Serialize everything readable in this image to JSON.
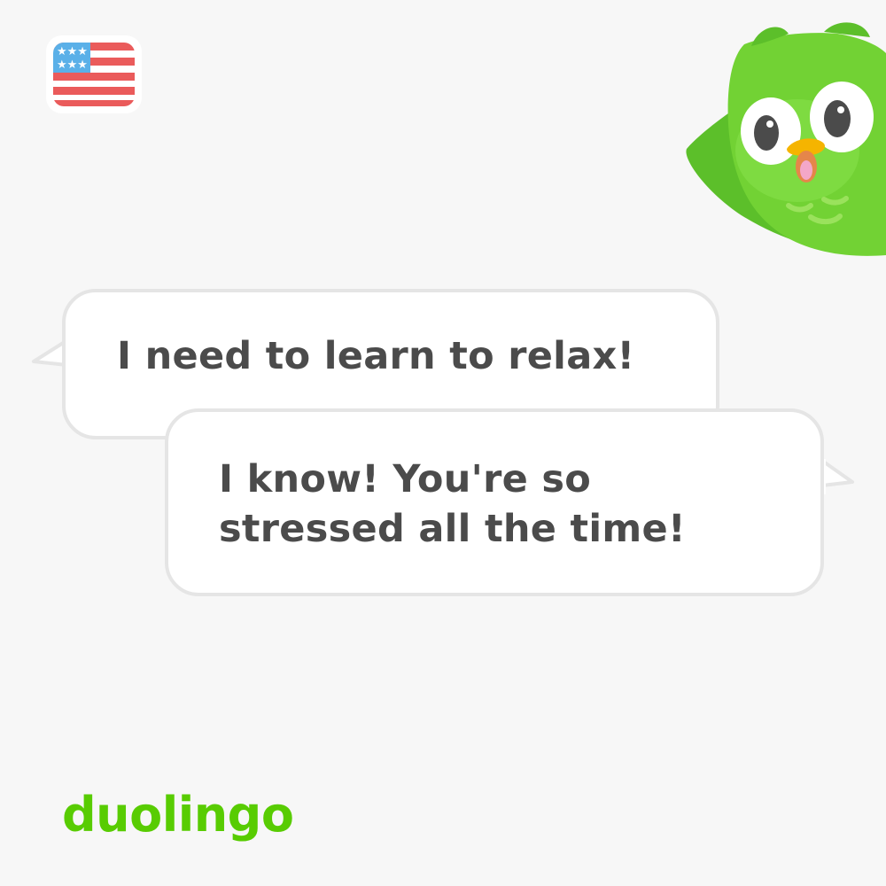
{
  "brand": {
    "wordmark": "duolingo",
    "accent_color": "#58cc02"
  },
  "language_flag": {
    "icon": "us-flag-icon"
  },
  "mascot": {
    "icon": "duo-owl-icon"
  },
  "conversation": [
    {
      "speaker": "left",
      "text": "I need to learn to relax!"
    },
    {
      "speaker": "right",
      "text": "I know! You're so\nstressed all the time!"
    }
  ],
  "colors": {
    "background": "#f7f7f7",
    "bubble_fill": "#ffffff",
    "bubble_border": "#e5e5e5",
    "text": "#4b4b4b",
    "owl_green": "#6fcf3a"
  }
}
